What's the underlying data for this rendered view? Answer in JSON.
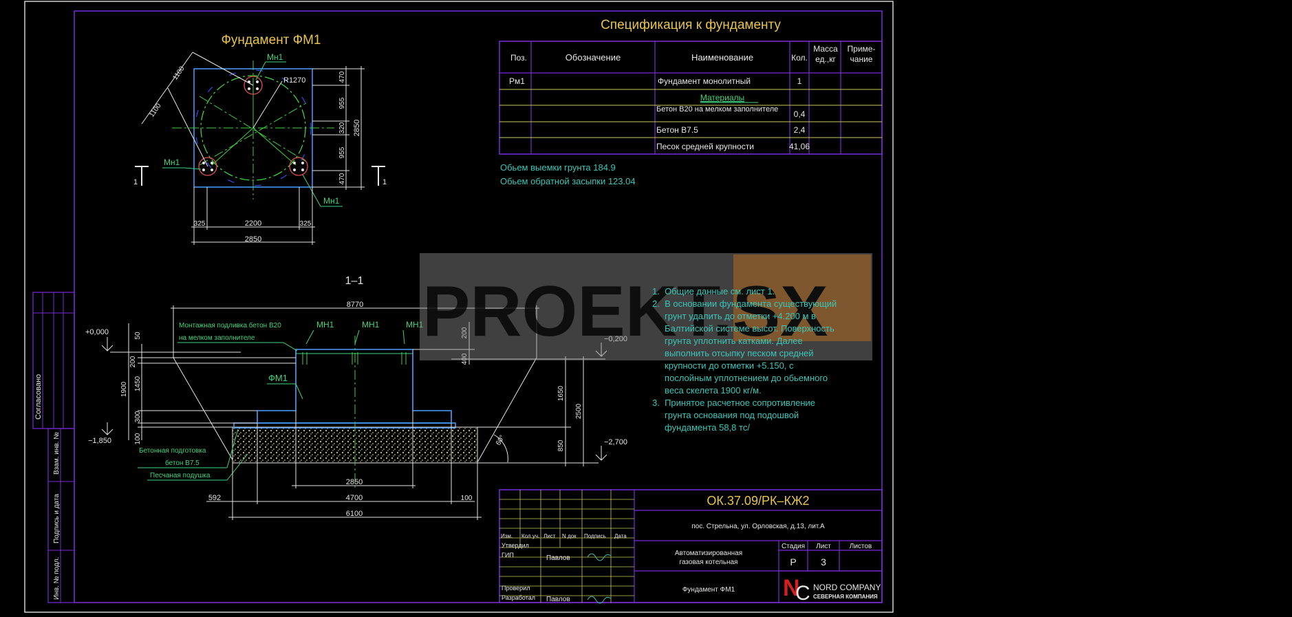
{
  "plan": {
    "title": "Фундамент ФМ1",
    "mn_labels": [
      "Мн1",
      "Мн1",
      "Мн1"
    ],
    "radius_label": "R1270",
    "dims_right": [
      "470",
      "955",
      "320",
      "955",
      "470"
    ],
    "dim_total_right": "2850",
    "dims_bottom": [
      "325",
      "2200",
      "325"
    ],
    "dim_total_bottom": "2850",
    "dims_diag": [
      "1100",
      "1100"
    ],
    "section_marks": [
      "1",
      "1"
    ]
  },
  "section": {
    "title": "1–1",
    "dim_top": "8770",
    "level_top": "+0,000",
    "level_mid": "−0,200",
    "level_bottom_left": "−1,850",
    "level_bottom_right": "−2,700",
    "note_grout": [
      "Монтажная подливка бетон В20",
      "на мелком заполнителе"
    ],
    "mn_labels": [
      "МН1",
      "МН1",
      "МН1"
    ],
    "fm_label": "ФМ1",
    "left_dims": [
      "50",
      "200",
      "1450",
      "1900",
      "300",
      "100"
    ],
    "right_dims": [
      "200",
      "400",
      "1650",
      "2500",
      "850"
    ],
    "angle": "60°",
    "note_prep": [
      "Бетонная подготовка",
      "бетон В7.5"
    ],
    "note_sand": "Песчаная подушка",
    "bottom_dims": [
      "2850",
      "592",
      "4700",
      "100",
      "6100"
    ]
  },
  "spec": {
    "title": "Спецификация к фундаменту",
    "headers": [
      "Поз.",
      "Обозначение",
      "Наименование",
      "Кол.",
      "Масса ед.,кг",
      "Приме- чание"
    ],
    "rows": [
      [
        "Рм1",
        "",
        "Фундамент монолитный",
        "1",
        "",
        ""
      ],
      [
        "",
        "",
        "Материалы",
        "",
        "",
        ""
      ],
      [
        "",
        "",
        "Бетон В20 на мелком заполнителе",
        "0,4",
        "",
        ""
      ],
      [
        "",
        "",
        "Бетон В7.5",
        "2,4",
        "",
        ""
      ],
      [
        "",
        "",
        "Песок средней крупности",
        "41,06",
        "",
        ""
      ]
    ],
    "volume_excavation": "Обьем выемки грунта 184.9",
    "volume_backfill": "Обьем обратной засыпки 123.04"
  },
  "watermark": "PROEKT.SX",
  "notes": [
    "1.  Общие данные см. лист 1.",
    "2.  В основании фундамента существующий",
    "     грунт удалить до отметки +4.200 м в",
    "     Балтийской системе высот. Поверхность",
    "     грунта уплотнить катками. Далее",
    "     выполнить отсыпку песком средней",
    "     крупности до отметки +5.150, с",
    "     послойным уплотнением до обьемного",
    "     веса скелета 1900 кг/м.",
    "3.  Принятое расчетное сопротивление",
    "     грунта основания под подошвой",
    "     фундамента 58,8 тс/"
  ],
  "side_stamp": {
    "agreed": "Согласовано",
    "labels": [
      "Инв. № подл.",
      "Подпись и дата",
      "Взам. инв. №"
    ]
  },
  "title_block": {
    "code": "ОК.37.09/РК–КЖ2",
    "address": "пос. Стрельна, ул. Орловская, д.13, лит.А",
    "col_headers": [
      "Изм.",
      "Кол.уч.",
      "Лист",
      "N док",
      "Подпись",
      "Дата"
    ],
    "roles": [
      "Утвердил",
      "ГИП",
      "Проверил",
      "Разработал"
    ],
    "names": [
      "Павлов",
      "Павлов"
    ],
    "object": [
      "Автоматизированная",
      "газовая котельная"
    ],
    "sheet_title": "Фундамент ФМ1",
    "stage_header": "Стадия",
    "sheet_header": "Лист",
    "sheets_header": "Листов",
    "stage": "Р",
    "sheet": "3",
    "sheets": "",
    "company": "NORD COMPANY",
    "company_sub": "СЕВЕРНАЯ КОМПАНИЯ"
  }
}
